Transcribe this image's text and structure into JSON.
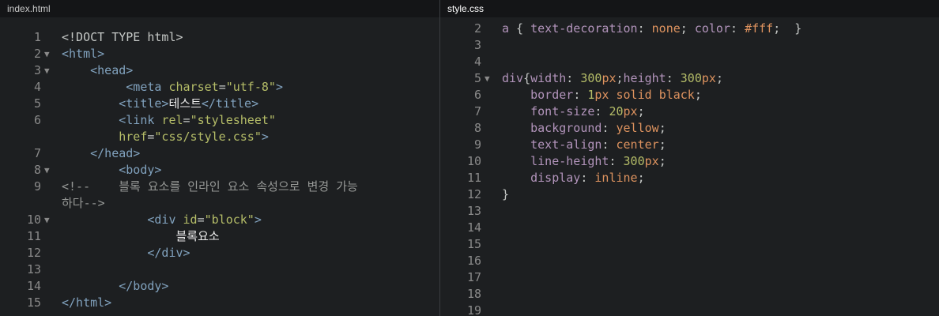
{
  "left": {
    "tab": "index.html",
    "lines": [
      {
        "n": "1",
        "fold": false,
        "segs": [
          {
            "c": "t-plain",
            "t": "<!DOCT TYPE html>"
          }
        ]
      },
      {
        "n": "2",
        "fold": true,
        "segs": [
          {
            "c": "t-tag",
            "t": "<html>"
          }
        ]
      },
      {
        "n": "3",
        "fold": true,
        "segs": [
          {
            "c": "t-plain",
            "t": "    "
          },
          {
            "c": "t-tag",
            "t": "<head>"
          }
        ]
      },
      {
        "n": "4",
        "fold": false,
        "segs": [
          {
            "c": "t-plain",
            "t": "         "
          },
          {
            "c": "t-tag",
            "t": "<meta "
          },
          {
            "c": "t-attr",
            "t": "charset"
          },
          {
            "c": "t-plain",
            "t": "="
          },
          {
            "c": "t-str",
            "t": "\"utf-8\""
          },
          {
            "c": "t-tag",
            "t": ">"
          }
        ]
      },
      {
        "n": "5",
        "fold": false,
        "segs": [
          {
            "c": "t-plain",
            "t": "        "
          },
          {
            "c": "t-tag",
            "t": "<title>"
          },
          {
            "c": "t-kor",
            "t": "테스트"
          },
          {
            "c": "t-tag",
            "t": "</title>"
          }
        ]
      },
      {
        "n": "6",
        "fold": false,
        "segs": [
          {
            "c": "t-plain",
            "t": "        "
          },
          {
            "c": "t-tag",
            "t": "<link "
          },
          {
            "c": "t-attr",
            "t": "rel"
          },
          {
            "c": "t-plain",
            "t": "="
          },
          {
            "c": "t-str",
            "t": "\"stylesheet\""
          }
        ]
      },
      {
        "n": "",
        "fold": false,
        "segs": [
          {
            "c": "t-plain",
            "t": "        "
          },
          {
            "c": "t-attr",
            "t": "href"
          },
          {
            "c": "t-plain",
            "t": "="
          },
          {
            "c": "t-str",
            "t": "\"css/style.css\""
          },
          {
            "c": "t-tag",
            "t": ">"
          }
        ]
      },
      {
        "n": "7",
        "fold": false,
        "segs": [
          {
            "c": "t-plain",
            "t": "    "
          },
          {
            "c": "t-tag",
            "t": "</head>"
          }
        ]
      },
      {
        "n": "8",
        "fold": true,
        "segs": [
          {
            "c": "t-plain",
            "t": "        "
          },
          {
            "c": "t-tag",
            "t": "<body>"
          }
        ]
      },
      {
        "n": "9",
        "fold": false,
        "segs": [
          {
            "c": "t-comment",
            "t": "<!--    블록 요소를 인라인 요소 속성으로 변경 가능"
          }
        ]
      },
      {
        "n": "",
        "fold": false,
        "segs": [
          {
            "c": "t-comment",
            "t": "하다-->"
          }
        ]
      },
      {
        "n": "10",
        "fold": true,
        "segs": [
          {
            "c": "t-plain",
            "t": "            "
          },
          {
            "c": "t-tag",
            "t": "<div "
          },
          {
            "c": "t-attr",
            "t": "id"
          },
          {
            "c": "t-plain",
            "t": "="
          },
          {
            "c": "t-str",
            "t": "\"block\""
          },
          {
            "c": "t-tag",
            "t": ">"
          }
        ]
      },
      {
        "n": "11",
        "fold": false,
        "segs": [
          {
            "c": "t-plain",
            "t": "                "
          },
          {
            "c": "t-kor",
            "t": "블록요소"
          }
        ]
      },
      {
        "n": "12",
        "fold": false,
        "segs": [
          {
            "c": "t-plain",
            "t": "            "
          },
          {
            "c": "t-tag",
            "t": "</div>"
          }
        ]
      },
      {
        "n": "13",
        "fold": false,
        "segs": []
      },
      {
        "n": "14",
        "fold": false,
        "segs": [
          {
            "c": "t-plain",
            "t": "        "
          },
          {
            "c": "t-tag",
            "t": "</body>"
          }
        ]
      },
      {
        "n": "15",
        "fold": false,
        "segs": [
          {
            "c": "t-tag",
            "t": "</html>"
          }
        ]
      }
    ]
  },
  "right": {
    "tab": "style.css",
    "lines": [
      {
        "n": "2",
        "fold": false,
        "segs": [
          {
            "c": "t-sel",
            "t": "a"
          },
          {
            "c": "t-punc",
            "t": " { "
          },
          {
            "c": "t-prop",
            "t": "text-decoration"
          },
          {
            "c": "t-punc",
            "t": ": "
          },
          {
            "c": "t-val",
            "t": "none"
          },
          {
            "c": "t-punc",
            "t": "; "
          },
          {
            "c": "t-prop",
            "t": "color"
          },
          {
            "c": "t-punc",
            "t": ": "
          },
          {
            "c": "t-hash",
            "t": "#fff"
          },
          {
            "c": "t-punc",
            "t": ";  }"
          }
        ]
      },
      {
        "n": "3",
        "fold": false,
        "segs": []
      },
      {
        "n": "4",
        "fold": false,
        "segs": []
      },
      {
        "n": "5",
        "fold": true,
        "segs": [
          {
            "c": "t-sel",
            "t": "div"
          },
          {
            "c": "t-punc",
            "t": "{"
          },
          {
            "c": "t-prop",
            "t": "width"
          },
          {
            "c": "t-punc",
            "t": ": "
          },
          {
            "c": "t-num",
            "t": "300"
          },
          {
            "c": "t-unit",
            "t": "px"
          },
          {
            "c": "t-punc",
            "t": ";"
          },
          {
            "c": "t-prop",
            "t": "height"
          },
          {
            "c": "t-punc",
            "t": ": "
          },
          {
            "c": "t-num",
            "t": "300"
          },
          {
            "c": "t-unit",
            "t": "px"
          },
          {
            "c": "t-punc",
            "t": ";"
          }
        ]
      },
      {
        "n": "6",
        "fold": false,
        "segs": [
          {
            "c": "t-plain",
            "t": "    "
          },
          {
            "c": "t-prop",
            "t": "border"
          },
          {
            "c": "t-punc",
            "t": ": "
          },
          {
            "c": "t-num",
            "t": "1"
          },
          {
            "c": "t-unit",
            "t": "px"
          },
          {
            "c": "t-punc",
            "t": " "
          },
          {
            "c": "t-val",
            "t": "solid"
          },
          {
            "c": "t-punc",
            "t": " "
          },
          {
            "c": "t-val",
            "t": "black"
          },
          {
            "c": "t-punc",
            "t": ";"
          }
        ]
      },
      {
        "n": "7",
        "fold": false,
        "segs": [
          {
            "c": "t-plain",
            "t": "    "
          },
          {
            "c": "t-prop",
            "t": "font-size"
          },
          {
            "c": "t-punc",
            "t": ": "
          },
          {
            "c": "t-num",
            "t": "20"
          },
          {
            "c": "t-unit",
            "t": "px"
          },
          {
            "c": "t-punc",
            "t": ";"
          }
        ]
      },
      {
        "n": "8",
        "fold": false,
        "segs": [
          {
            "c": "t-plain",
            "t": "    "
          },
          {
            "c": "t-prop",
            "t": "background"
          },
          {
            "c": "t-punc",
            "t": ": "
          },
          {
            "c": "t-val",
            "t": "yellow"
          },
          {
            "c": "t-punc",
            "t": ";"
          }
        ]
      },
      {
        "n": "9",
        "fold": false,
        "segs": [
          {
            "c": "t-plain",
            "t": "    "
          },
          {
            "c": "t-prop",
            "t": "text-align"
          },
          {
            "c": "t-punc",
            "t": ": "
          },
          {
            "c": "t-val",
            "t": "center"
          },
          {
            "c": "t-punc",
            "t": ";"
          }
        ]
      },
      {
        "n": "10",
        "fold": false,
        "segs": [
          {
            "c": "t-plain",
            "t": "    "
          },
          {
            "c": "t-prop",
            "t": "line-height"
          },
          {
            "c": "t-punc",
            "t": ": "
          },
          {
            "c": "t-num",
            "t": "300"
          },
          {
            "c": "t-unit",
            "t": "px"
          },
          {
            "c": "t-punc",
            "t": ";"
          }
        ]
      },
      {
        "n": "11",
        "fold": false,
        "segs": [
          {
            "c": "t-plain",
            "t": "    "
          },
          {
            "c": "t-prop",
            "t": "display"
          },
          {
            "c": "t-punc",
            "t": ": "
          },
          {
            "c": "t-val",
            "t": "inline"
          },
          {
            "c": "t-punc",
            "t": ";"
          }
        ]
      },
      {
        "n": "12",
        "fold": false,
        "segs": [
          {
            "c": "t-punc",
            "t": "}"
          }
        ]
      },
      {
        "n": "13",
        "fold": false,
        "segs": []
      },
      {
        "n": "14",
        "fold": false,
        "segs": []
      },
      {
        "n": "15",
        "fold": false,
        "segs": []
      },
      {
        "n": "16",
        "fold": false,
        "segs": []
      },
      {
        "n": "17",
        "fold": false,
        "segs": []
      },
      {
        "n": "18",
        "fold": false,
        "segs": []
      },
      {
        "n": "19",
        "fold": false,
        "segs": []
      }
    ]
  }
}
